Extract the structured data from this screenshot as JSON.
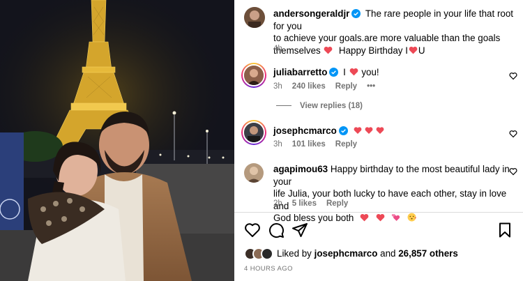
{
  "post": {
    "author": "andersongeraldjr",
    "caption_1": "The rare people in your life that root for you",
    "caption_2": "to achieve your goals.are more valuable than the goals",
    "caption_3a": "themselves",
    "caption_3b": "Happy Birthday I",
    "caption_3c": "U",
    "time": "4h"
  },
  "comments": [
    {
      "user": "juliabarretto",
      "text_a": "I",
      "text_b": "you!",
      "time": "3h",
      "likes": "240 likes",
      "reply": "Reply",
      "more": "•••",
      "view_replies": "View replies (18)"
    },
    {
      "user": "josephcmarco",
      "time": "3h",
      "likes": "101 likes",
      "reply": "Reply"
    },
    {
      "user": "agapimou63",
      "text_1": "Happy birthday to the most beautiful lady in your",
      "text_2": "life Julia, your both lucky to have each other, stay in love and",
      "text_3": "God bless you both",
      "time": "2h",
      "likes": "5 likes",
      "reply": "Reply"
    }
  ],
  "liked_by": {
    "prefix": "Liked by",
    "user": "josephcmarco",
    "middle": "and",
    "count": "26,857 others"
  },
  "timestamp": "4 HOURS AGO",
  "icons": [
    "heart-icon",
    "comment-icon",
    "share-icon",
    "bookmark-icon",
    "verified-badge-icon",
    "more-icon"
  ],
  "colors": {
    "heart": "#ed4956",
    "verified": "#0095f6",
    "meta": "#737373",
    "divider": "#dbdbdb"
  }
}
